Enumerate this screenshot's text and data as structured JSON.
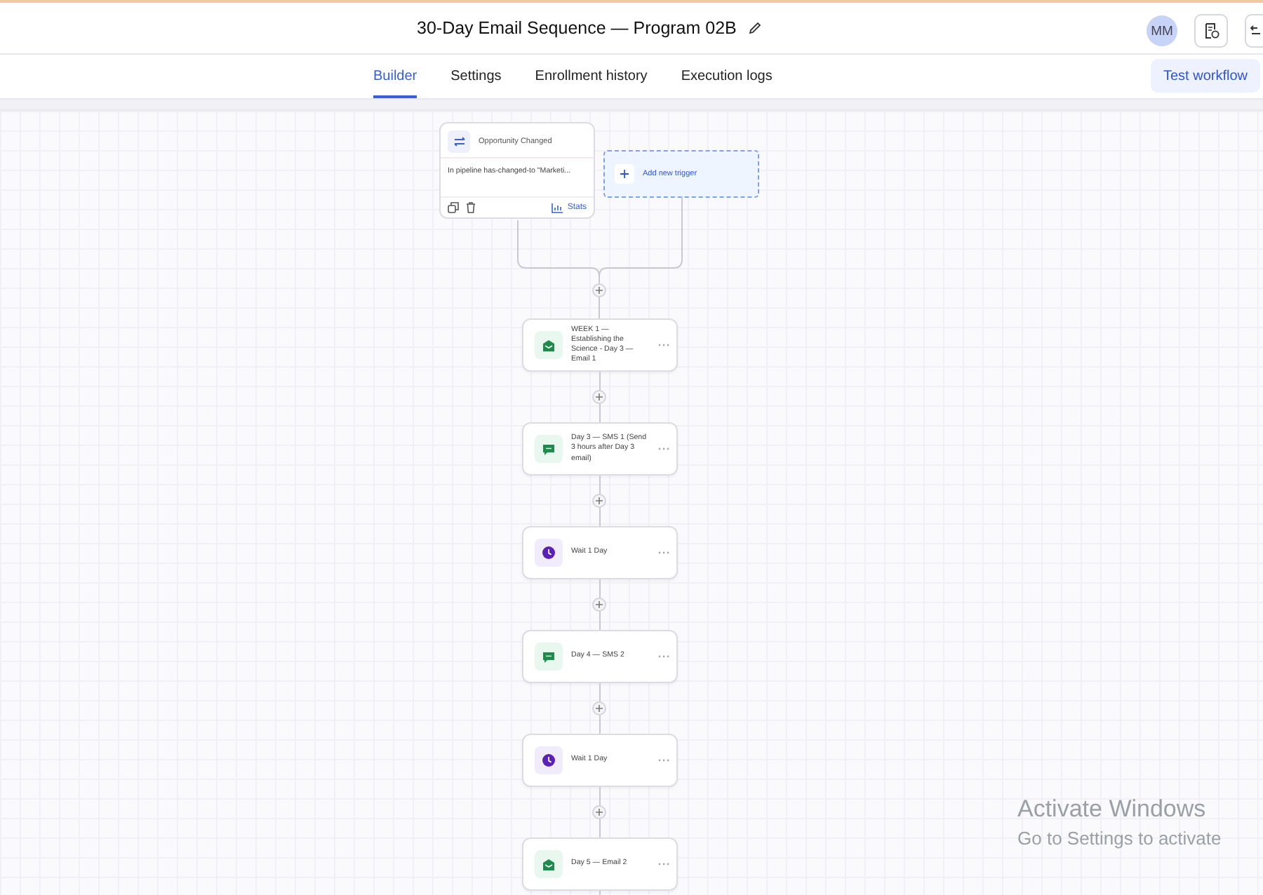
{
  "header": {
    "title": "30-Day Email Sequence — Program 02B",
    "avatar": "MM"
  },
  "tabs": [
    {
      "label": "Builder",
      "selected": true
    },
    {
      "label": "Settings",
      "selected": false
    },
    {
      "label": "Enrollment history",
      "selected": false
    },
    {
      "label": "Execution logs",
      "selected": false
    }
  ],
  "test_button": "Test workflow",
  "trigger": {
    "title": "Opportunity Changed",
    "description": "In pipeline has-changed-to \"Marketi...",
    "stats": "Stats"
  },
  "add_trigger": "Add new trigger",
  "steps": [
    {
      "kind": "email",
      "label": "WEEK 1 — Establishing the Science - Day 3 — Email 1"
    },
    {
      "kind": "sms",
      "label": "Day 3 — SMS 1 (Send 3 hours after Day 3 email)"
    },
    {
      "kind": "wait",
      "label": "Wait 1 Day"
    },
    {
      "kind": "sms",
      "label": "Day 4 — SMS 2"
    },
    {
      "kind": "wait",
      "label": "Wait 1 Day"
    },
    {
      "kind": "email",
      "label": "Day 5 — Email 2"
    }
  ],
  "os_overlay": {
    "title": "Activate Windows",
    "subtitle": "Go to Settings to activate"
  }
}
